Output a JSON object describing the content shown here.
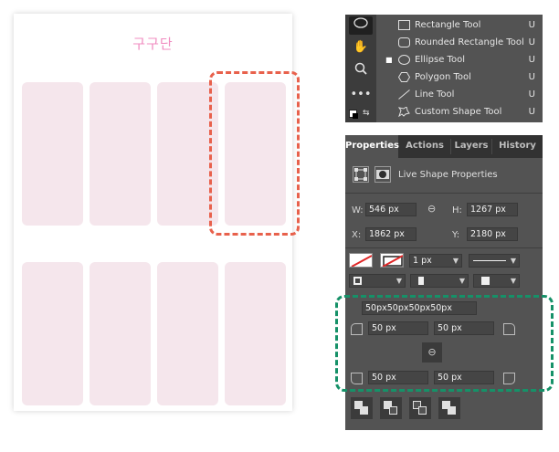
{
  "document": {
    "title": "구구단",
    "cards": [
      {
        "row": 0,
        "col": 0
      },
      {
        "row": 0,
        "col": 1
      },
      {
        "row": 0,
        "col": 2
      },
      {
        "row": 0,
        "col": 3
      },
      {
        "row": 1,
        "col": 0
      },
      {
        "row": 1,
        "col": 1
      },
      {
        "row": 1,
        "col": 2
      },
      {
        "row": 1,
        "col": 3
      }
    ],
    "card_color": "#f5e6ec",
    "title_color": "#f08cc0",
    "highlight_color": "#e8614c"
  },
  "tool_strip": {
    "icons": [
      "ellipse-icon",
      "hand-icon",
      "zoom-icon",
      "more-icon",
      "color-swatch-icon",
      "swap-icon"
    ]
  },
  "tool_menu": {
    "items": [
      {
        "label": "Rectangle Tool",
        "shortcut": "U",
        "icon": "rectangle-icon",
        "selected": false
      },
      {
        "label": "Rounded Rectangle Tool",
        "shortcut": "U",
        "icon": "rounded-rectangle-icon",
        "selected": false
      },
      {
        "label": "Ellipse Tool",
        "shortcut": "U",
        "icon": "ellipse-icon",
        "selected": true
      },
      {
        "label": "Polygon Tool",
        "shortcut": "U",
        "icon": "polygon-icon",
        "selected": false
      },
      {
        "label": "Line Tool",
        "shortcut": "U",
        "icon": "line-icon",
        "selected": false
      },
      {
        "label": "Custom Shape Tool",
        "shortcut": "U",
        "icon": "custom-shape-icon",
        "selected": false
      }
    ]
  },
  "properties": {
    "tabs": [
      "Properties",
      "Actions",
      "Layers",
      "History"
    ],
    "active_tab": "Properties",
    "header_label": "Live Shape Properties",
    "w_label": "W:",
    "w_value": "546 px",
    "h_label": "H:",
    "h_value": "1267 px",
    "x_label": "X:",
    "x_value": "1862 px",
    "y_label": "Y:",
    "y_value": "2180 px",
    "stroke_width": "1 px",
    "corner_summary": "50px50px50px50px",
    "corner_tl": "50 px",
    "corner_tr": "50 px",
    "corner_bl": "50 px",
    "corner_br": "50 px",
    "panel_bg": "#535353",
    "highlight_color": "#169168"
  }
}
